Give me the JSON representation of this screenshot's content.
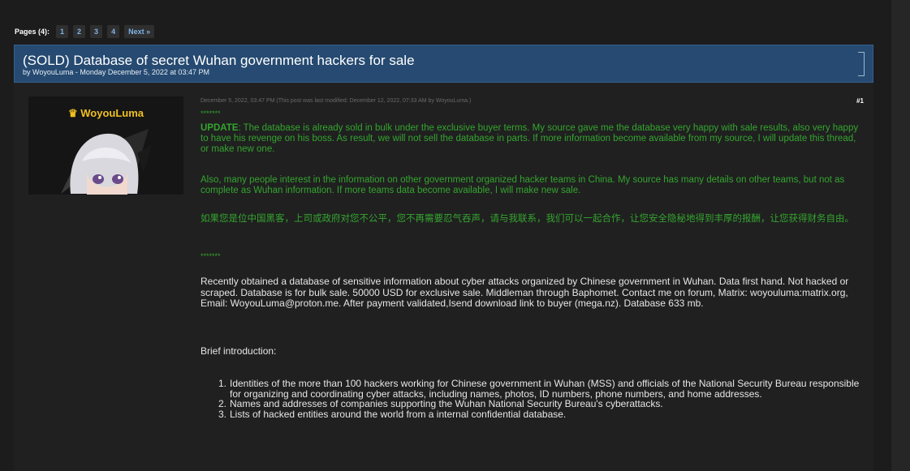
{
  "pagination": {
    "label": "Pages (4):",
    "pages": [
      "1",
      "2",
      "3",
      "4"
    ],
    "next": "Next »"
  },
  "thread": {
    "title": "(SOLD) Database of secret Wuhan government hackers for sale",
    "byline": "by WoyouLuma - Monday December 5, 2022 at 03:47 PM"
  },
  "author": {
    "crown": "♛",
    "name": "WoyouLuma"
  },
  "post": {
    "meta": "December 5, 2022, 03:47 PM  (This post was last modified: December 12, 2022, 07:33 AM by WoyouLuma.)",
    "number": "#1",
    "stars_top": "*******",
    "update_label": "UPDATE",
    "update_text": ": The database is already sold in bulk under the exclusive buyer terms. My source gave me the database very happy with sale results, also very happy to have his revenge on his boss.  As result, we will not sell the database in parts. If more information become available from my source, I will update this thread, or make new one.",
    "also_text": "Also, many people interest in the information on other government organized hacker teams in China. My source has many details on other teams, but not as complete as Wuhan information. If more teams data become available, I will make new sale.",
    "chinese_text": "如果您是位中国黑客，上司或政府对您不公平，您不再需要忍气吞声，请与我联系，我们可以一起合作，让您安全隐秘地得到丰厚的报酬，让您获得财务自由。",
    "stars_bottom": "*******",
    "main_text": "Recently obtained a database of sensitive information about cyber attacks organized by Chinese government in Wuhan. Data first hand. Not hacked or scraped. Database is for bulk sale. 50000 USD for exclusive sale. Middleman through Baphomet. Contact me on forum, Matrix: woyouluma:matrix.org, Email: WoyouLuma@proton.me. After payment validated,Isend download link to buyer (mega.nz). Database 633 mb.",
    "brief_intro": "Brief introduction:",
    "list": [
      {
        "num": "1.",
        "text": "Identities of the more than 100 hackers working for Chinese government in Wuhan (MSS) and officials of the National Security Bureau responsible for organizing and coordinating cyber attacks, including names, photos, ID numbers, phone numbers, and home addresses."
      },
      {
        "num": "2.",
        "text": "Names and addresses of companies supporting the Wuhan National Security Bureau's cyberattacks."
      },
      {
        "num": "3.",
        "text": "Lists of hacked entities around the world from a internal confidential database."
      }
    ]
  },
  "colors": {
    "header_bg": "#264a71",
    "green_text": "#34a52f",
    "username": "#f0c020"
  }
}
